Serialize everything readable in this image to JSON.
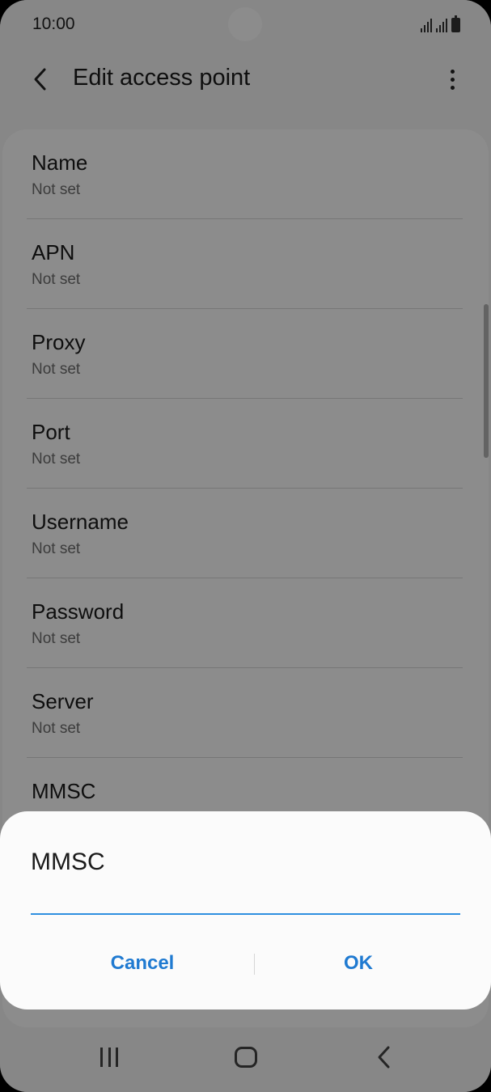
{
  "status_bar": {
    "time": "10:00",
    "icons": [
      "signal-icon",
      "signal-icon",
      "battery-icon"
    ]
  },
  "header": {
    "title": "Edit access point",
    "back_icon": "chevron-left-icon",
    "more_icon": "more-vertical-icon"
  },
  "settings": {
    "items": [
      {
        "label": "Name",
        "value": "Not set"
      },
      {
        "label": "APN",
        "value": "Not set"
      },
      {
        "label": "Proxy",
        "value": "Not set"
      },
      {
        "label": "Port",
        "value": "Not set"
      },
      {
        "label": "Username",
        "value": "Not set"
      },
      {
        "label": "Password",
        "value": "Not set"
      },
      {
        "label": "Server",
        "value": "Not set"
      },
      {
        "label": "MMSC",
        "value": ""
      }
    ]
  },
  "dialog": {
    "title": "MMSC",
    "input_value": "",
    "cancel_label": "Cancel",
    "ok_label": "OK"
  },
  "nav": {
    "recents_icon": "recents-icon",
    "home_icon": "home-icon",
    "back_icon": "back-icon"
  },
  "colors": {
    "accent": "#1f7ad1",
    "input_underline": "#2f8fe0",
    "background": "#f6f6f6",
    "card": "#ffffff"
  }
}
